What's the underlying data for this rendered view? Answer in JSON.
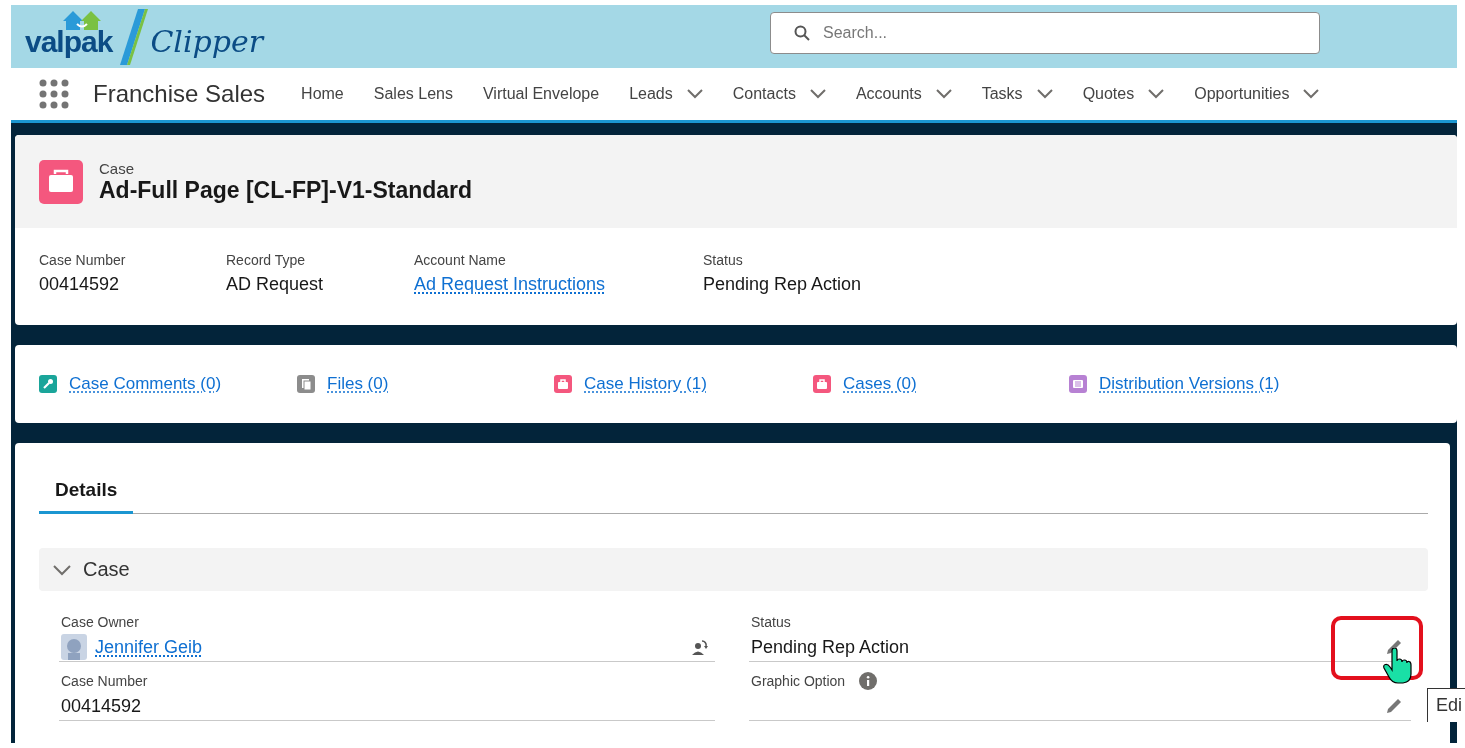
{
  "brand": {
    "logo_left": "valpak",
    "logo_right": "Clipper"
  },
  "search": {
    "placeholder": "Search..."
  },
  "nav": {
    "app_name": "Franchise Sales",
    "items": [
      {
        "label": "Home",
        "dropdown": false
      },
      {
        "label": "Sales Lens",
        "dropdown": false
      },
      {
        "label": "Virtual Envelope",
        "dropdown": false
      },
      {
        "label": "Leads",
        "dropdown": true
      },
      {
        "label": "Contacts",
        "dropdown": true
      },
      {
        "label": "Accounts",
        "dropdown": true
      },
      {
        "label": "Tasks",
        "dropdown": true
      },
      {
        "label": "Quotes",
        "dropdown": true
      },
      {
        "label": "Opportunities",
        "dropdown": true
      }
    ]
  },
  "record": {
    "object": "Case",
    "title": "Ad-Full Page [CL-FP]-V1-Standard",
    "highlights": [
      {
        "label": "Case Number",
        "value": "00414592",
        "kind": "text"
      },
      {
        "label": "Record Type",
        "value": "AD Request",
        "kind": "text"
      },
      {
        "label": "Account Name",
        "value": "Ad Request Instructions",
        "kind": "link"
      },
      {
        "label": "Status",
        "value": "Pending Rep Action",
        "kind": "text"
      }
    ]
  },
  "related": [
    {
      "label": "Case Comments (0)",
      "kind": "wrench",
      "color": "#1aa59a"
    },
    {
      "label": "Files (0)",
      "kind": "files",
      "color": "#8c8c8c"
    },
    {
      "label": "Case History (1)",
      "kind": "case",
      "color": "#f4577e"
    },
    {
      "label": "Cases (0)",
      "kind": "case",
      "color": "#f4577e"
    },
    {
      "label": "Distribution Versions (1)",
      "kind": "versions",
      "color": "#b781d3"
    }
  ],
  "details": {
    "tabs": [
      {
        "label": "Details",
        "selected": true
      }
    ],
    "section": {
      "title": "Case",
      "expanded": true
    },
    "columns": [
      [
        {
          "label": "Case Owner",
          "value": "Jennifer Geib",
          "kind": "owner"
        },
        {
          "label": "Case Number",
          "value": "00414592",
          "kind": "text"
        }
      ],
      [
        {
          "label": "Status",
          "value": "Pending Rep Action",
          "kind": "editable",
          "highlighted": true
        },
        {
          "label": "Graphic Option",
          "kind": "editable",
          "info": true,
          "highlighted": false
        }
      ]
    ]
  },
  "tooltip": {
    "text": "Edi"
  }
}
